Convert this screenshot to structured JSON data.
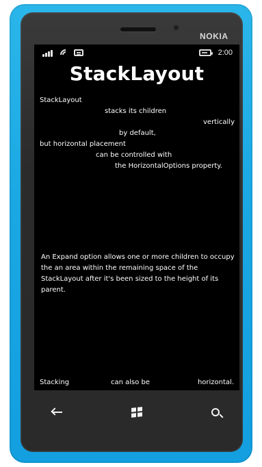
{
  "device": {
    "brand": "NOKIA"
  },
  "status_bar": {
    "time": "2:00"
  },
  "app": {
    "title": "StackLayout",
    "lines": [
      "StackLayout",
      "stacks its children",
      "vertically",
      "by default,",
      "but horizontal placement",
      "can be controlled with",
      "the HorizontalOptions property."
    ],
    "paragraph": "An Expand option allows one or more children to occupy the an area within the remaining space of the StackLayout after it's been sized to the height of its parent.",
    "bottom_labels": [
      "Stacking",
      "can also be",
      "horizontal."
    ]
  }
}
